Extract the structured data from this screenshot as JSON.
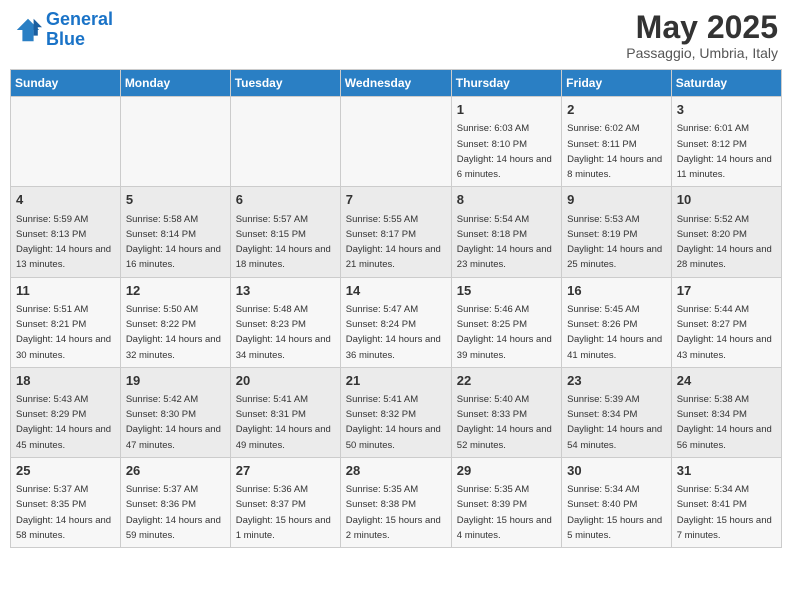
{
  "logo": {
    "line1": "General",
    "line2": "Blue"
  },
  "title": "May 2025",
  "location": "Passaggio, Umbria, Italy",
  "weekdays": [
    "Sunday",
    "Monday",
    "Tuesday",
    "Wednesday",
    "Thursday",
    "Friday",
    "Saturday"
  ],
  "weeks": [
    [
      {
        "day": "",
        "sunrise": "",
        "sunset": "",
        "daylight": ""
      },
      {
        "day": "",
        "sunrise": "",
        "sunset": "",
        "daylight": ""
      },
      {
        "day": "",
        "sunrise": "",
        "sunset": "",
        "daylight": ""
      },
      {
        "day": "",
        "sunrise": "",
        "sunset": "",
        "daylight": ""
      },
      {
        "day": "1",
        "sunrise": "Sunrise: 6:03 AM",
        "sunset": "Sunset: 8:10 PM",
        "daylight": "Daylight: 14 hours and 6 minutes."
      },
      {
        "day": "2",
        "sunrise": "Sunrise: 6:02 AM",
        "sunset": "Sunset: 8:11 PM",
        "daylight": "Daylight: 14 hours and 8 minutes."
      },
      {
        "day": "3",
        "sunrise": "Sunrise: 6:01 AM",
        "sunset": "Sunset: 8:12 PM",
        "daylight": "Daylight: 14 hours and 11 minutes."
      }
    ],
    [
      {
        "day": "4",
        "sunrise": "Sunrise: 5:59 AM",
        "sunset": "Sunset: 8:13 PM",
        "daylight": "Daylight: 14 hours and 13 minutes."
      },
      {
        "day": "5",
        "sunrise": "Sunrise: 5:58 AM",
        "sunset": "Sunset: 8:14 PM",
        "daylight": "Daylight: 14 hours and 16 minutes."
      },
      {
        "day": "6",
        "sunrise": "Sunrise: 5:57 AM",
        "sunset": "Sunset: 8:15 PM",
        "daylight": "Daylight: 14 hours and 18 minutes."
      },
      {
        "day": "7",
        "sunrise": "Sunrise: 5:55 AM",
        "sunset": "Sunset: 8:17 PM",
        "daylight": "Daylight: 14 hours and 21 minutes."
      },
      {
        "day": "8",
        "sunrise": "Sunrise: 5:54 AM",
        "sunset": "Sunset: 8:18 PM",
        "daylight": "Daylight: 14 hours and 23 minutes."
      },
      {
        "day": "9",
        "sunrise": "Sunrise: 5:53 AM",
        "sunset": "Sunset: 8:19 PM",
        "daylight": "Daylight: 14 hours and 25 minutes."
      },
      {
        "day": "10",
        "sunrise": "Sunrise: 5:52 AM",
        "sunset": "Sunset: 8:20 PM",
        "daylight": "Daylight: 14 hours and 28 minutes."
      }
    ],
    [
      {
        "day": "11",
        "sunrise": "Sunrise: 5:51 AM",
        "sunset": "Sunset: 8:21 PM",
        "daylight": "Daylight: 14 hours and 30 minutes."
      },
      {
        "day": "12",
        "sunrise": "Sunrise: 5:50 AM",
        "sunset": "Sunset: 8:22 PM",
        "daylight": "Daylight: 14 hours and 32 minutes."
      },
      {
        "day": "13",
        "sunrise": "Sunrise: 5:48 AM",
        "sunset": "Sunset: 8:23 PM",
        "daylight": "Daylight: 14 hours and 34 minutes."
      },
      {
        "day": "14",
        "sunrise": "Sunrise: 5:47 AM",
        "sunset": "Sunset: 8:24 PM",
        "daylight": "Daylight: 14 hours and 36 minutes."
      },
      {
        "day": "15",
        "sunrise": "Sunrise: 5:46 AM",
        "sunset": "Sunset: 8:25 PM",
        "daylight": "Daylight: 14 hours and 39 minutes."
      },
      {
        "day": "16",
        "sunrise": "Sunrise: 5:45 AM",
        "sunset": "Sunset: 8:26 PM",
        "daylight": "Daylight: 14 hours and 41 minutes."
      },
      {
        "day": "17",
        "sunrise": "Sunrise: 5:44 AM",
        "sunset": "Sunset: 8:27 PM",
        "daylight": "Daylight: 14 hours and 43 minutes."
      }
    ],
    [
      {
        "day": "18",
        "sunrise": "Sunrise: 5:43 AM",
        "sunset": "Sunset: 8:29 PM",
        "daylight": "Daylight: 14 hours and 45 minutes."
      },
      {
        "day": "19",
        "sunrise": "Sunrise: 5:42 AM",
        "sunset": "Sunset: 8:30 PM",
        "daylight": "Daylight: 14 hours and 47 minutes."
      },
      {
        "day": "20",
        "sunrise": "Sunrise: 5:41 AM",
        "sunset": "Sunset: 8:31 PM",
        "daylight": "Daylight: 14 hours and 49 minutes."
      },
      {
        "day": "21",
        "sunrise": "Sunrise: 5:41 AM",
        "sunset": "Sunset: 8:32 PM",
        "daylight": "Daylight: 14 hours and 50 minutes."
      },
      {
        "day": "22",
        "sunrise": "Sunrise: 5:40 AM",
        "sunset": "Sunset: 8:33 PM",
        "daylight": "Daylight: 14 hours and 52 minutes."
      },
      {
        "day": "23",
        "sunrise": "Sunrise: 5:39 AM",
        "sunset": "Sunset: 8:34 PM",
        "daylight": "Daylight: 14 hours and 54 minutes."
      },
      {
        "day": "24",
        "sunrise": "Sunrise: 5:38 AM",
        "sunset": "Sunset: 8:34 PM",
        "daylight": "Daylight: 14 hours and 56 minutes."
      }
    ],
    [
      {
        "day": "25",
        "sunrise": "Sunrise: 5:37 AM",
        "sunset": "Sunset: 8:35 PM",
        "daylight": "Daylight: 14 hours and 58 minutes."
      },
      {
        "day": "26",
        "sunrise": "Sunrise: 5:37 AM",
        "sunset": "Sunset: 8:36 PM",
        "daylight": "Daylight: 14 hours and 59 minutes."
      },
      {
        "day": "27",
        "sunrise": "Sunrise: 5:36 AM",
        "sunset": "Sunset: 8:37 PM",
        "daylight": "Daylight: 15 hours and 1 minute."
      },
      {
        "day": "28",
        "sunrise": "Sunrise: 5:35 AM",
        "sunset": "Sunset: 8:38 PM",
        "daylight": "Daylight: 15 hours and 2 minutes."
      },
      {
        "day": "29",
        "sunrise": "Sunrise: 5:35 AM",
        "sunset": "Sunset: 8:39 PM",
        "daylight": "Daylight: 15 hours and 4 minutes."
      },
      {
        "day": "30",
        "sunrise": "Sunrise: 5:34 AM",
        "sunset": "Sunset: 8:40 PM",
        "daylight": "Daylight: 15 hours and 5 minutes."
      },
      {
        "day": "31",
        "sunrise": "Sunrise: 5:34 AM",
        "sunset": "Sunset: 8:41 PM",
        "daylight": "Daylight: 15 hours and 7 minutes."
      }
    ]
  ]
}
